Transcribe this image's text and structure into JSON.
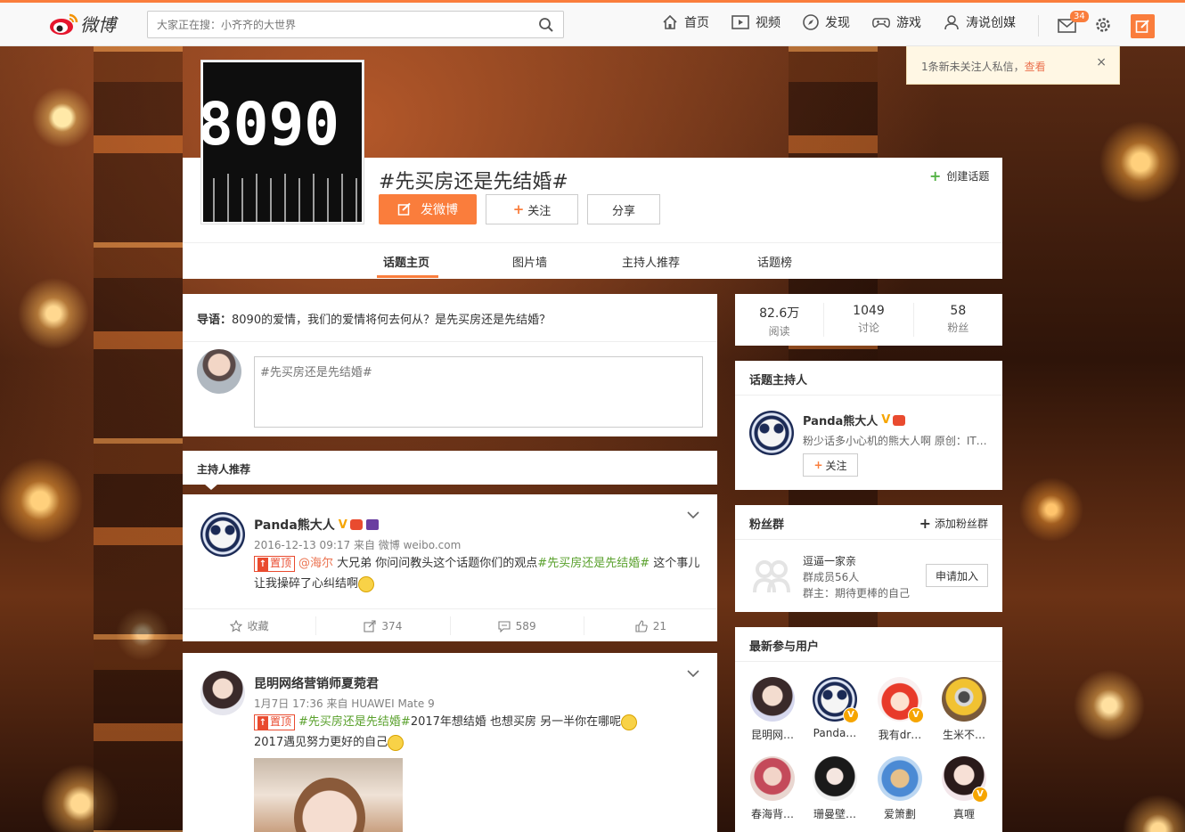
{
  "nav": {
    "logo_text": "微博",
    "search_placeholder": "大家正在搜：小齐齐的大世界",
    "items": [
      {
        "label": "首页"
      },
      {
        "label": "视频"
      },
      {
        "label": "发现"
      },
      {
        "label": "游戏"
      },
      {
        "label": "涛说创媒"
      }
    ],
    "mail_badge": "34"
  },
  "notice": {
    "text": "1条新未关注人私信，",
    "link": "查看",
    "close": "×"
  },
  "topic": {
    "cover_text": "8090",
    "title": "#先买房还是先结婚#",
    "create_label": "创建话题",
    "post_button": "发微博",
    "follow_button": "关注",
    "share_button": "分享",
    "tabs": [
      {
        "label": "话题主页",
        "active": true
      },
      {
        "label": "图片墙"
      },
      {
        "label": "主持人推荐"
      },
      {
        "label": "话题榜"
      }
    ]
  },
  "intro": {
    "label": "导语：",
    "text": "8090的爱情，我们的爱情将何去何从？是先买房还是先结婚？",
    "compose_placeholder": "#先买房还是先结婚#"
  },
  "recommend_header": "主持人推荐",
  "posts": [
    {
      "name": "Panda熊大人",
      "meta": "2016-12-13 09:17 来自 微博 weibo.com",
      "pin_label": "置顶",
      "mention": "@海尔",
      "text1": " 大兄弟 你问问教头这个话题你们的观点",
      "topic_link": "#先买房还是先结婚#",
      "text2": " 这个事儿让我操碎了心纠结啊",
      "actions": {
        "fav": "收藏",
        "forward": "374",
        "comment": "589",
        "like": "21"
      }
    },
    {
      "name": "昆明网络营销师夏菀君",
      "meta": "1月7日 17:36 来自 HUAWEI Mate 9",
      "pin_label": "置顶",
      "topic_link": "#先买房还是先结婚#",
      "text1": "2017年想结婚  也想买房  另一半你在哪呢",
      "text2": "2017遇见努力更好的自己"
    }
  ],
  "stats": [
    {
      "num": "82.6万",
      "label": "阅读"
    },
    {
      "num": "1049",
      "label": "讨论"
    },
    {
      "num": "58",
      "label": "粉丝"
    }
  ],
  "host": {
    "title": "话题主持人",
    "name": "Panda熊大人",
    "desc": "粉少话多小心机的熊大人啊 原创：IT…",
    "follow": "关注"
  },
  "fans_group": {
    "title": "粉丝群",
    "add_label": "添加粉丝群",
    "group_name": "逗逼一家亲",
    "members": "群成员56人",
    "owner": "群主：期待更棒的自己",
    "join": "申请加入"
  },
  "users": {
    "title": "最新参与用户",
    "list": [
      {
        "name": "昆明网…"
      },
      {
        "name": "Panda…",
        "v": true
      },
      {
        "name": "我有dr…",
        "v": true
      },
      {
        "name": "生米不…"
      },
      {
        "name": "春海背…"
      },
      {
        "name": "珊曼壁…"
      },
      {
        "name": "爱箫劃"
      },
      {
        "name": "真喱",
        "v": true
      }
    ]
  },
  "colors": {
    "accent": "#fa7d3c",
    "link": "#eb7350",
    "topic_green": "#5aa12d",
    "gold_v": "#f6a500"
  }
}
